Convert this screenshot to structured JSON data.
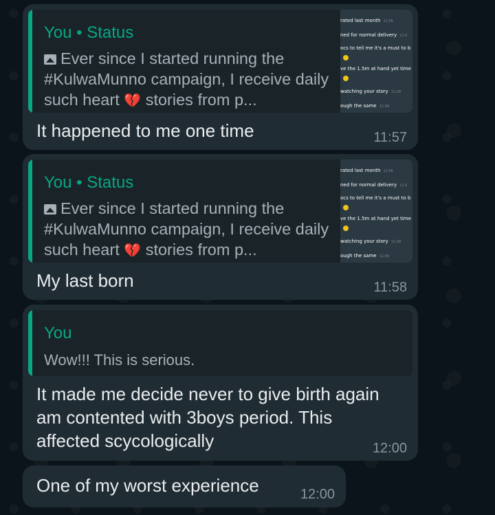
{
  "messages": [
    {
      "quote_author": "You • Status",
      "quote_text_pre": "Ever since I started running the #KulwaMunno campaign, I receive daily such heart ",
      "quote_text_post": " stories from p...",
      "heart": "💔",
      "body": "It happened to me one time",
      "time": "11:57"
    },
    {
      "quote_author": "You • Status",
      "quote_text_pre": "Ever since I started running the #KulwaMunno campaign, I receive daily such heart ",
      "quote_text_post": " stories from p...",
      "heart": "💔",
      "body": "My last born",
      "time": "11:58"
    },
    {
      "quote_author": "You",
      "quote_text": "Wow!!! This is serious.",
      "body": "It made me decide never to give birth again am contented  with 3boys period. This affected scycologically",
      "time": "12:00"
    },
    {
      "body": "One of my worst experience",
      "time": "12:00"
    }
  ],
  "thumbnail": {
    "lines": [
      {
        "text": "rated last month",
        "time": "11:06"
      },
      {
        "text": "ned for normal delivery",
        "time": "11:0"
      },
      {
        "text": "ocs to tell me it's a must to b",
        "time": ""
      },
      {
        "text": "ve the 1.5m at hand yet time",
        "time": ""
      },
      {
        "text": "watching your story",
        "time": "11:09"
      },
      {
        "text": "ough the same",
        "time": "11:09"
      }
    ]
  },
  "colors": {
    "background": "#0b141a",
    "bubble": "#202c33",
    "quote_bg": "#1a2328",
    "accent": "#06a884",
    "text": "#e9edef",
    "meta": "#8696a0"
  }
}
